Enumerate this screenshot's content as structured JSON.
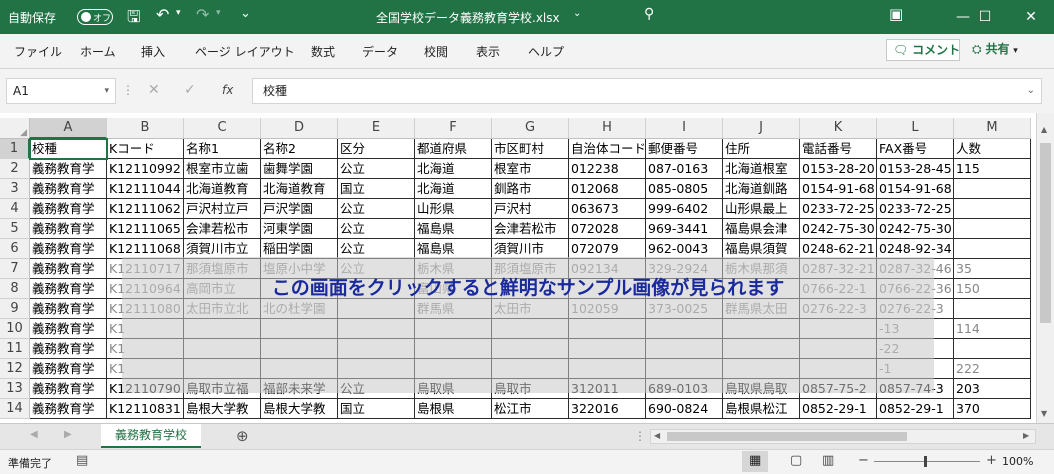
{
  "titlebar": {
    "autosave": "自動保存",
    "toggle": "オフ",
    "filename": "全国学校データ義務教育学校.xlsx",
    "window_buttons": [
      "—",
      "☐",
      "✕"
    ]
  },
  "ribbon": {
    "tabs": [
      "ファイル",
      "ホーム",
      "挿入",
      "ページ レイアウト",
      "数式",
      "データ",
      "校閲",
      "表示",
      "ヘルプ"
    ],
    "comment": "コメント",
    "share": "共有"
  },
  "formula": {
    "namebox": "A1",
    "fx": "fx",
    "value": "校種"
  },
  "columns": [
    "A",
    "B",
    "C",
    "D",
    "E",
    "F",
    "G",
    "H",
    "I",
    "J",
    "K",
    "L",
    "M"
  ],
  "rows": [
    [
      "校種",
      "Kコード",
      "名称1",
      "名称2",
      "区分",
      "都道府県",
      "市区町村",
      "自治体コード",
      "郵便番号",
      "住所",
      "電話番号",
      "FAX番号",
      "人数"
    ],
    [
      "義務教育学",
      "K12110992",
      "根室市立歯",
      "歯舞学園",
      "公立",
      "北海道",
      "根室市",
      "012238",
      "087-0163",
      "北海道根室",
      "0153-28-20",
      "0153-28-45",
      "115"
    ],
    [
      "義務教育学",
      "K12111044",
      "北海道教育",
      "北海道教育",
      "国立",
      "北海道",
      "釧路市",
      "012068",
      "085-0805",
      "北海道釧路",
      "0154-91-68",
      "0154-91-68",
      ""
    ],
    [
      "義務教育学",
      "K12111062",
      "戸沢村立戸",
      "戸沢学園",
      "公立",
      "山形県",
      "戸沢村",
      "063673",
      "999-6402",
      "山形県最上",
      "0233-72-25",
      "0233-72-25",
      ""
    ],
    [
      "義務教育学",
      "K12111065",
      "会津若松市",
      "河東学園",
      "公立",
      "福島県",
      "会津若松市",
      "072028",
      "969-3441",
      "福島県会津",
      "0242-75-30",
      "0242-75-30",
      ""
    ],
    [
      "義務教育学",
      "K12111068",
      "須賀川市立",
      "稲田学園",
      "公立",
      "福島県",
      "須賀川市",
      "072079",
      "962-0043",
      "福島県須賀",
      "0248-62-21",
      "0248-92-34",
      ""
    ],
    [
      "義務教育学",
      "K12110717",
      "那須塩原市",
      "塩原小中学",
      "公立",
      "栃木県",
      "那須塩原市",
      "092134",
      "329-2924",
      "栃木県那須",
      "0287-32-21",
      "0287-32-46",
      "35"
    ],
    [
      "義務教育学",
      "K12110964",
      "高岡市立",
      "",
      "",
      "富山県",
      "",
      "",
      "",
      "",
      "0766-22-1",
      "0766-22-36",
      "150"
    ],
    [
      "義務教育学",
      "K12111080",
      "太田市立北",
      "北の杜学園",
      "",
      "群馬県",
      "太田市",
      "102059",
      "373-0025",
      "群馬県太田",
      "0276-22-3",
      "0276-22-3",
      ""
    ],
    [
      "義務教育学",
      "K1",
      "",
      "",
      "",
      "",
      "",
      "",
      "",
      "",
      "",
      "-13",
      "114"
    ],
    [
      "義務教育学",
      "K1",
      "",
      "",
      "",
      "",
      "",
      "",
      "",
      "",
      "",
      "-22",
      ""
    ],
    [
      "義務教育学",
      "K1",
      "",
      "",
      "",
      "",
      "",
      "",
      "",
      "",
      "",
      "-1",
      "222"
    ],
    [
      "義務教育学",
      "K12110790",
      "鳥取市立福",
      "福部未来学",
      "公立",
      "鳥取県",
      "鳥取市",
      "312011",
      "689-0103",
      "鳥取県鳥取",
      "0857-75-2",
      "0857-74-3",
      "203"
    ],
    [
      "義務教育学",
      "K12110831",
      "島根大学教",
      "島根大学教",
      "国立",
      "島根県",
      "松江市",
      "322016",
      "690-0824",
      "島根県松江",
      "0852-29-1",
      "0852-29-1",
      "370"
    ]
  ],
  "overlay_text": "この画面をクリックすると鮮明なサンプル画像が見られます",
  "sheet": {
    "tab": "義務教育学校",
    "add": "⊕"
  },
  "status": {
    "ready": "準備完了",
    "zoom": "100%"
  }
}
